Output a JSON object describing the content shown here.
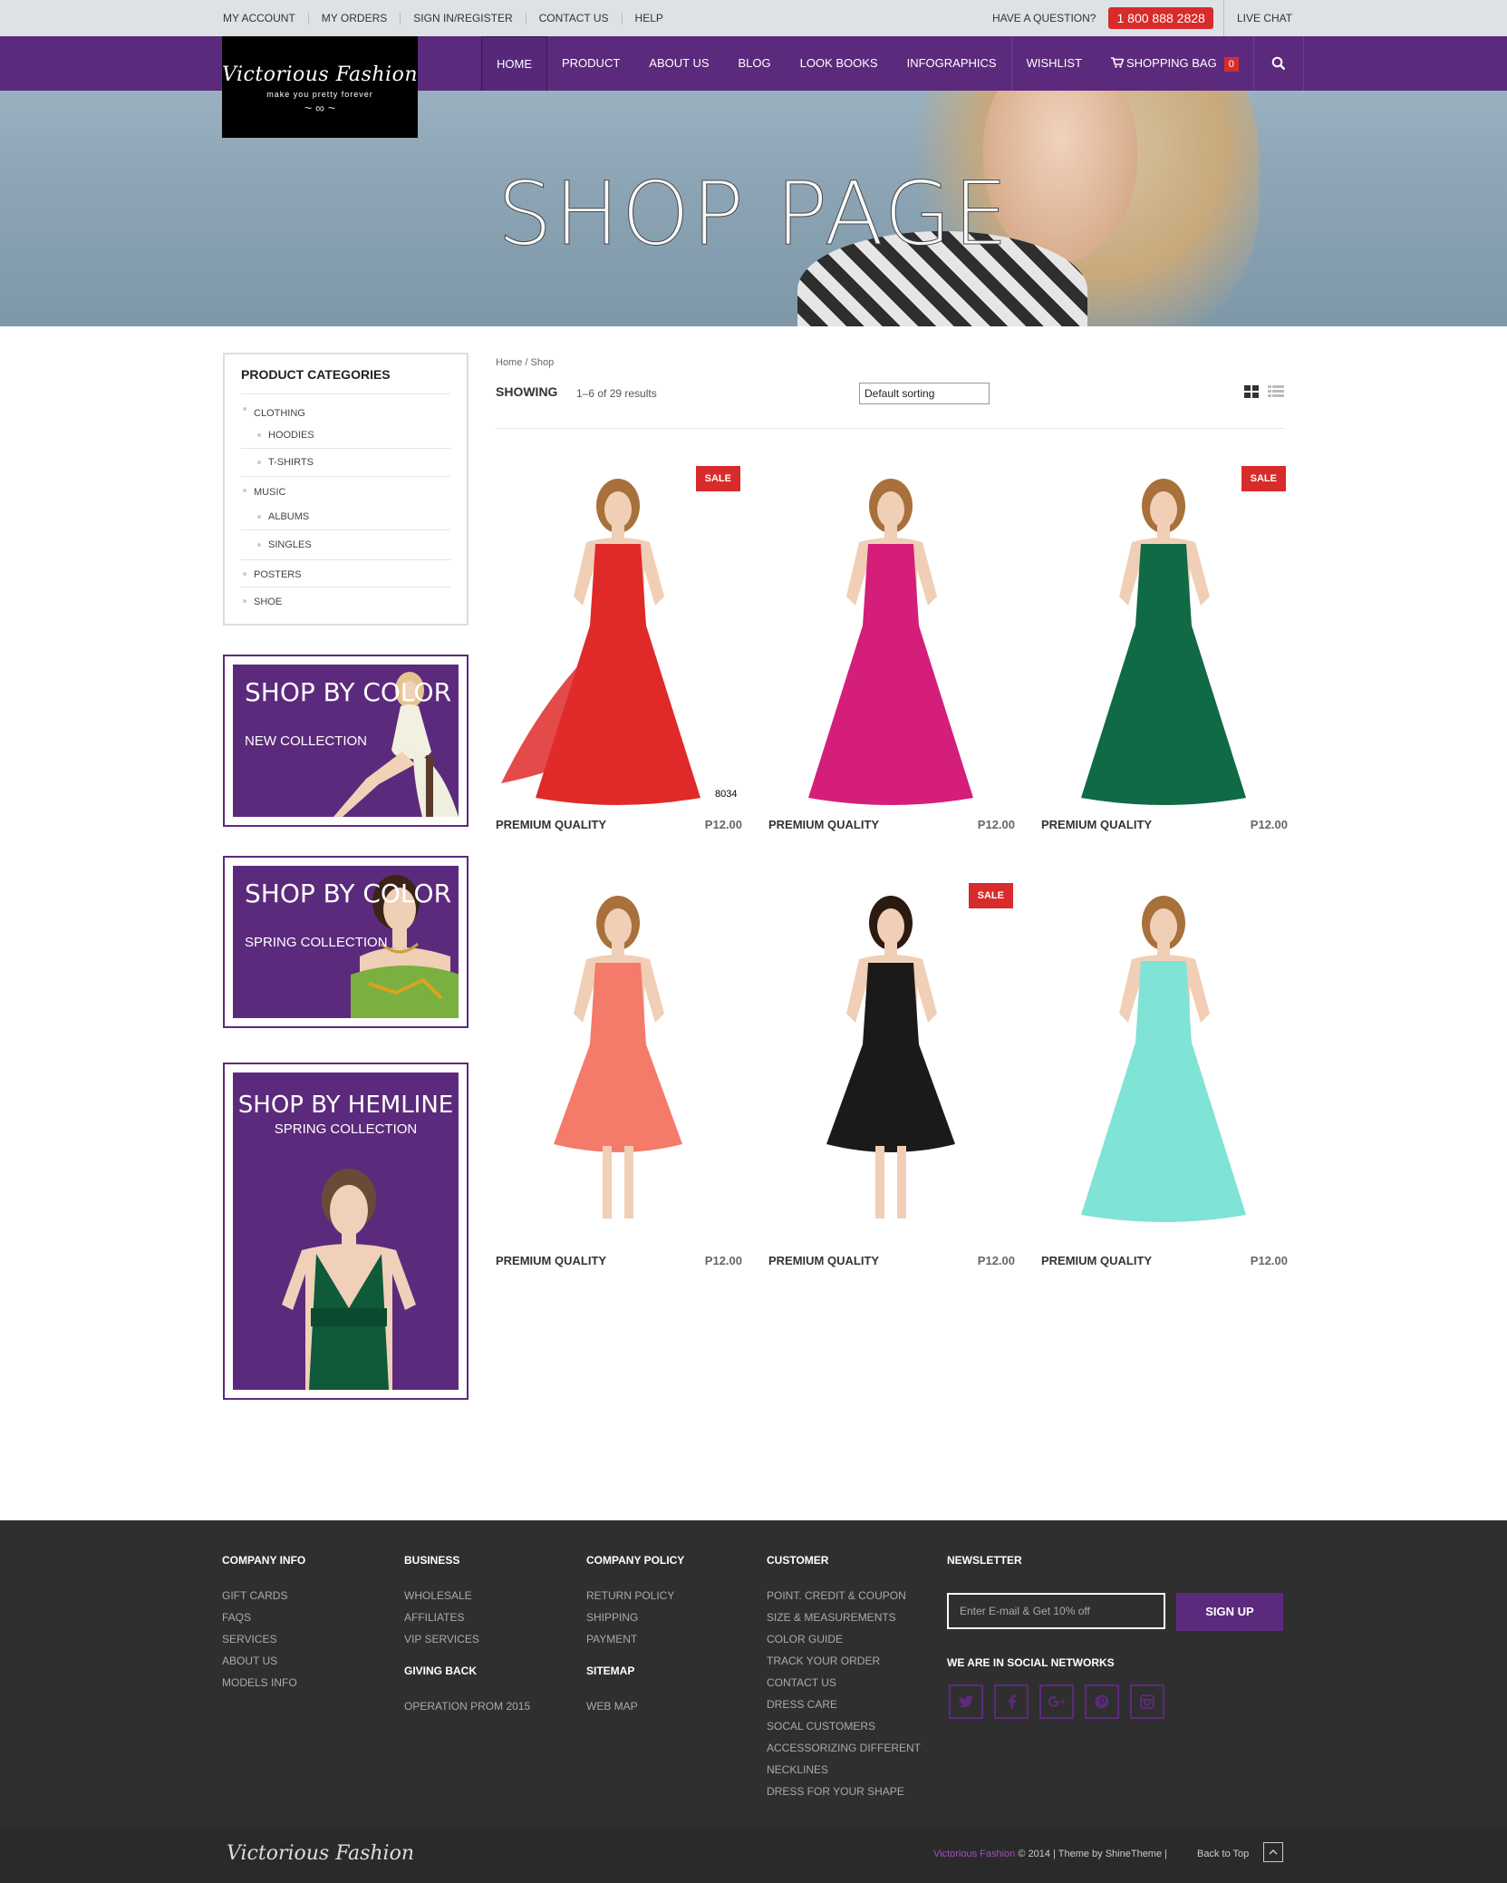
{
  "topbar": {
    "links": [
      "MY ACCOUNT",
      "MY ORDERS",
      "SIGN IN/REGISTER",
      "CONTACT US",
      "HELP"
    ],
    "question": "HAVE A QUESTION?",
    "phone": "1 800 888 2828",
    "live_chat": "LIVE CHAT"
  },
  "logo": {
    "name": "Victorious Fashion",
    "tagline": "make you pretty forever"
  },
  "nav": {
    "items": [
      "HOME",
      "PRODUCT",
      "ABOUT US",
      "BLOG",
      "LOOK BOOKS",
      "INFOGRAPHICS"
    ],
    "wishlist": "WISHLIST",
    "bag_label": "SHOPPING BAG",
    "bag_count": "0",
    "active": "HOME"
  },
  "hero": {
    "title": "SHOP PAGE"
  },
  "sidebar": {
    "categories_title": "PRODUCT CATEGORIES",
    "categories": [
      {
        "label": "CLOTHING",
        "level": 0
      },
      {
        "label": "HOODIES",
        "level": 1
      },
      {
        "label": "T-SHIRTS",
        "level": 1
      },
      {
        "label": "MUSIC",
        "level": 0
      },
      {
        "label": "ALBUMS",
        "level": 1
      },
      {
        "label": "SINGLES",
        "level": 1
      },
      {
        "label": "POSTERS",
        "level": 0
      },
      {
        "label": "SHOE",
        "level": 0
      }
    ],
    "promos": [
      {
        "title": "SHOP BY COLOR",
        "subtitle": "NEW COLLECTION"
      },
      {
        "title": "SHOP BY COLOR",
        "subtitle": "SPRING COLLECTION"
      },
      {
        "title": "SHOP BY HEMLINE",
        "subtitle": "SPRING COLLECTION"
      }
    ]
  },
  "shop": {
    "breadcrumb": "Home / Shop",
    "showing_label": "SHOWING",
    "result_count": "1–6 of 29 results",
    "sort_value": "Default sorting",
    "sale_label": "SALE",
    "products": [
      {
        "name": "PREMIUM QUALITY",
        "price": "P12.00",
        "sale": true,
        "color": "#e02a2a",
        "sku": "8034"
      },
      {
        "name": "PREMIUM QUALITY",
        "price": "P12.00",
        "sale": false,
        "color": "#d41e7a",
        "sku": ""
      },
      {
        "name": "PREMIUM QUALITY",
        "price": "P12.00",
        "sale": true,
        "color": "#0f6a45",
        "sku": ""
      },
      {
        "name": "PREMIUM QUALITY",
        "price": "P12.00",
        "sale": false,
        "color": "#f47a6a",
        "sku": ""
      },
      {
        "name": "PREMIUM QUALITY",
        "price": "P12.00",
        "sale": true,
        "color": "#1a1a1a",
        "sku": ""
      },
      {
        "name": "PREMIUM QUALITY",
        "price": "P12.00",
        "sale": false,
        "color": "#7fe3d6",
        "sku": ""
      }
    ]
  },
  "footer": {
    "columns": [
      {
        "title": "COMPANY INFO",
        "links": [
          "GIFT CARDS",
          "FAQS",
          "SERVICES",
          "ABOUT US",
          "MODELS INFO"
        ]
      },
      {
        "title": "BUSINESS",
        "links": [
          "WHOLESALE",
          "AFFILIATES",
          "VIP SERVICES"
        ]
      },
      {
        "title": "COMPANY POLICY",
        "links": [
          "RETURN POLICY",
          "SHIPPING",
          "PAYMENT"
        ]
      },
      {
        "title": "CUSTOMER",
        "links": [
          "POINT. CREDIT & COUPON",
          "SIZE & MEASUREMENTS",
          "COLOR GUIDE",
          "TRACK YOUR ORDER",
          "CONTACT US",
          "DRESS CARE",
          "SOCAL CUSTOMERS",
          "ACCESSORIZING DIFFERENT",
          "NECKLINES",
          "DRESS FOR YOUR SHAPE"
        ]
      }
    ],
    "giving_back": {
      "title": "GIVING BACK",
      "links": [
        "OPERATION PROM 2015"
      ]
    },
    "sitemap": {
      "title": "SITEMAP",
      "links": [
        "WEB MAP"
      ]
    },
    "newsletter": {
      "title": "NEWSLETTER",
      "placeholder": "Enter E-mail & Get 10% off",
      "button": "SIGN UP",
      "social_title": "WE ARE IN SOCIAL NETWORKS",
      "social": [
        "twitter-icon",
        "facebook-icon",
        "google-plus-icon",
        "pinterest-icon",
        "instagram-icon"
      ]
    },
    "bottom": {
      "logo": "Victorious Fashion",
      "brand": "Victorious Fashion",
      "copyright": " © 2014 | Theme by ShineTheme | ",
      "back_to_top": "Back to Top"
    }
  },
  "colors": {
    "purple": "#5c2a7d",
    "red": "#d82b2b",
    "footer": "#2f2f2f"
  }
}
